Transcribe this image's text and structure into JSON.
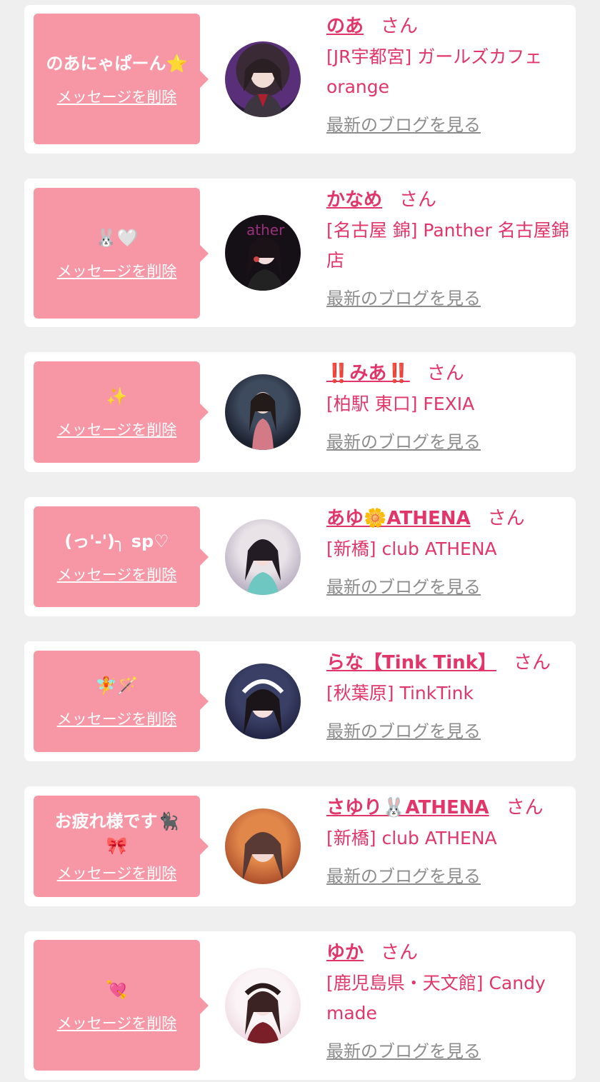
{
  "ui": {
    "delete_label": "メッセージを削除",
    "blog_label": "最新のブログを見る",
    "honorific": "さん"
  },
  "colors": {
    "accent": "#e2366a",
    "bubble": "#f797a6",
    "muted": "#8d8d8d",
    "background": "#efefef"
  },
  "items": [
    {
      "message": "のあにゃぱーん⭐",
      "message_2": "",
      "name": "のあ",
      "shop": "[JR宇都宮] ガールズカフェ orange"
    },
    {
      "message": "🐰🤍",
      "message_2": "",
      "name": "かなめ",
      "shop": "[名古屋 錦] Panther 名古屋錦店"
    },
    {
      "message": "✨",
      "message_2": "",
      "name": "‼️みあ‼️",
      "shop": "[柏駅 東口] FEXIA"
    },
    {
      "message": "(っ'-')╮ sp♡",
      "message_2": "",
      "name": "あゆ🌼ATHENA",
      "shop": "[新橋] club ATHENA"
    },
    {
      "message": "🧚🪄",
      "message_2": "",
      "name": "らな【Tink Tink】",
      "shop": "[秋葉原] TinkTink"
    },
    {
      "message": "お疲れ様です🐈‍⬛",
      "message_2": "🎀",
      "name": "さゆり🐰ATHENA",
      "shop": "[新橋] club ATHENA"
    },
    {
      "message": "💘",
      "message_2": "",
      "name": "ゆか",
      "shop": "[鹿児島県・天文館] Candy made"
    }
  ]
}
